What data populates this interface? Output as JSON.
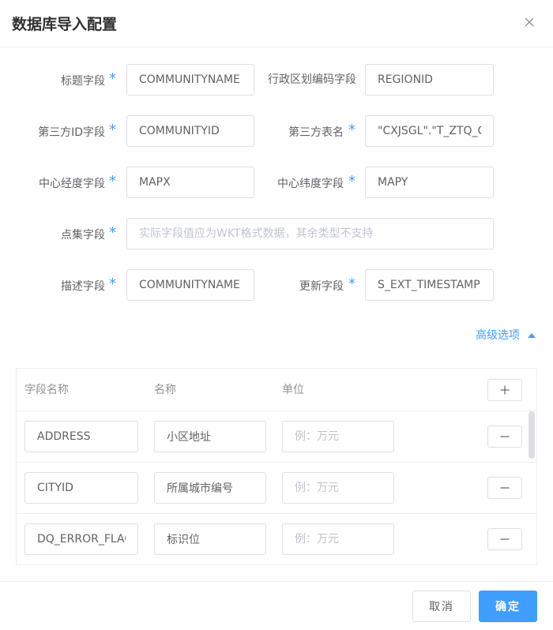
{
  "dialog": {
    "title": "数据库导入配置",
    "close_icon": "close-icon"
  },
  "form": {
    "required_mark": "*",
    "title_field": {
      "label": "标题字段",
      "value": "COMMUNITYNAME"
    },
    "region_code_field": {
      "label": "行政区划编码字段",
      "value": "REGIONID"
    },
    "third_party_id_field": {
      "label": "第三方ID字段",
      "value": "COMMUNITYID"
    },
    "third_party_table": {
      "label": "第三方表名",
      "value": "\"CXJSGL\".\"T_ZTQ_C"
    },
    "center_lng_field": {
      "label": "中心经度字段",
      "value": "MAPX"
    },
    "center_lat_field": {
      "label": "中心纬度字段",
      "value": "MAPY"
    },
    "point_set_field": {
      "label": "点集字段",
      "value": "",
      "placeholder": "实际字段值应为WKT格式数据，其余类型不支持"
    },
    "description_field": {
      "label": "描述字段",
      "value": "COMMUNITYNAME"
    },
    "update_field": {
      "label": "更新字段",
      "value": "S_EXT_TIMESTAMP"
    }
  },
  "advanced": {
    "label": "高级选项",
    "icon": "caret-up-icon"
  },
  "table": {
    "headers": {
      "field_name": "字段名称",
      "name": "名称",
      "unit": "单位"
    },
    "add_icon": "plus-icon",
    "remove_icon": "minus-icon",
    "rows": [
      {
        "field_name": "ADDRESS",
        "name": "小区地址",
        "unit": "",
        "unit_placeholder": "例：万元"
      },
      {
        "field_name": "CITYID",
        "name": "所属城市编号",
        "unit": "",
        "unit_placeholder": "例：万元"
      },
      {
        "field_name": "DQ_ERROR_FLAG",
        "name": "标识位",
        "unit": "",
        "unit_placeholder": "例：万元"
      }
    ]
  },
  "footer": {
    "cancel_label": "取消",
    "ok_label": "确定"
  },
  "colors": {
    "accent": "#409eff",
    "border": "#dcdfe6",
    "text": "#606266",
    "placeholder": "#c0c4cc"
  }
}
